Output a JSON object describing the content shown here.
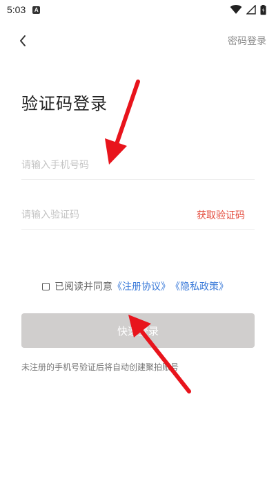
{
  "status_bar": {
    "time": "5:03",
    "notification_badge": "A",
    "icons": [
      "wifi-icon",
      "signal-icon",
      "battery-icon"
    ]
  },
  "nav": {
    "back_icon": "chevron-left-icon",
    "password_login_label": "密码登录"
  },
  "page": {
    "title": "验证码登录"
  },
  "form": {
    "phone_placeholder": "请输入手机号码",
    "phone_value": "",
    "code_placeholder": "请输入验证码",
    "code_value": "",
    "get_code_label": "获取验证码"
  },
  "agreement": {
    "checked": false,
    "text": "已阅读并同意",
    "terms_link": "《注册协议》",
    "privacy_link": "《隐私政策》"
  },
  "login_button": {
    "label": "快速登录"
  },
  "notice": "未注册的手机号验证后将自动创建聚拍账号",
  "colors": {
    "accent_red": "#e44b3c",
    "link_blue": "#3a7ad9",
    "button_disabled": "#d0cecd",
    "annotation_arrow": "#e8141c"
  }
}
